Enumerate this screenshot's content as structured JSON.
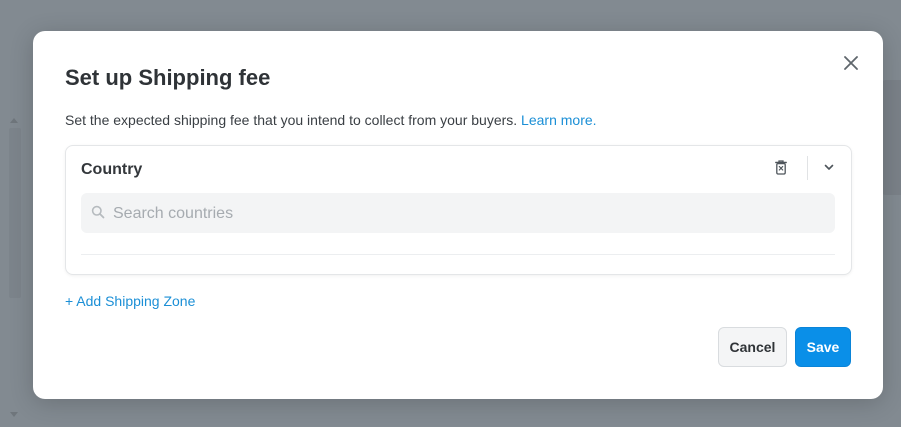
{
  "modal": {
    "title": "Set up Shipping fee",
    "description": "Set the expected shipping fee that you intend to collect from your buyers.",
    "learn_more": "Learn more.",
    "close_icon": "close-icon"
  },
  "zone": {
    "title": "Country",
    "delete_icon": "trash-icon",
    "expand_icon": "chevron-down-icon",
    "search_placeholder": "Search countries",
    "search_value": ""
  },
  "add_zone_label": "+ Add Shipping Zone",
  "buttons": {
    "cancel": "Cancel",
    "save": "Save"
  },
  "colors": {
    "accent": "#0a8fe8",
    "link": "#1b8fd6",
    "overlay": "#828a91"
  }
}
